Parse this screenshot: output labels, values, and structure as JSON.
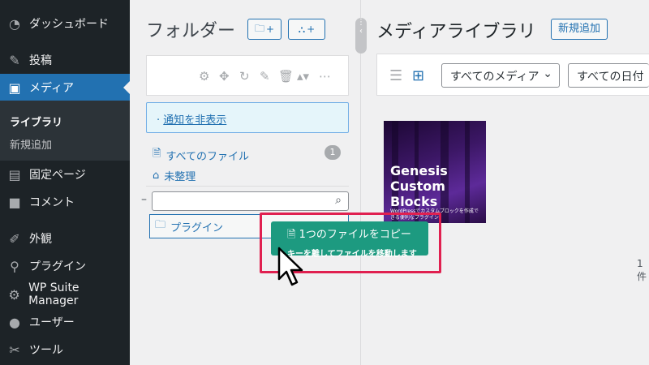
{
  "sidebar": {
    "items": [
      {
        "label": "ダッシュボード",
        "icon": "dashboard-icon"
      },
      {
        "label": "投稿",
        "icon": "pin-icon"
      },
      {
        "label": "メディア",
        "icon": "media-icon"
      },
      {
        "label": "固定ページ",
        "icon": "page-icon"
      },
      {
        "label": "コメント",
        "icon": "comment-icon"
      },
      {
        "label": "外観",
        "icon": "brush-icon"
      },
      {
        "label": "プラグイン",
        "icon": "plugin-icon"
      },
      {
        "label": "WP Suite Manager",
        "icon": "gear-icon"
      },
      {
        "label": "ユーザー",
        "icon": "user-icon"
      },
      {
        "label": "ツール",
        "icon": "wrench-icon"
      }
    ],
    "submenu": {
      "library": "ライブラリ",
      "add_new": "新規追加"
    }
  },
  "folders": {
    "title": "フォルダー",
    "add_folder_label": "+",
    "add_subfolder_label": "+",
    "notice": "通知を非表示",
    "all_files": "すべてのファイル",
    "all_files_count": "1",
    "uncategorized": "未整理",
    "plugin_folder": "プラグイン",
    "search_placeholder": ""
  },
  "media": {
    "title": "メディアライブラリ",
    "add_new": "新規追加",
    "type_filter": "すべてのメディア",
    "date_filter": "すべての日付",
    "item_count": "1件",
    "thumbnail": {
      "title": "Genesis Custom Blocks",
      "subtitle": "WordPressでカスタムブロックを作成できる便利なプラグイン"
    }
  },
  "drag": {
    "line1": "1つのファイルをコピー",
    "line2": "キーを離してファイルを移動します"
  },
  "colors": {
    "admin_bg": "#1d2327",
    "accent": "#2271b1",
    "drag_tooltip": "#1d9a80",
    "highlight": "#e02050"
  }
}
